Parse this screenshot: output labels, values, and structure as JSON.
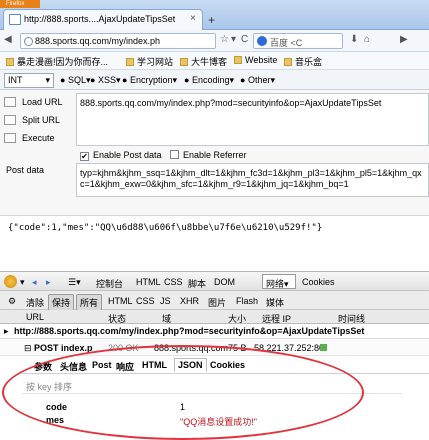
{
  "browser": {
    "brand_button": "Firefox",
    "tab_title": "http://888.sports....AjaxUpdateTipsSet",
    "tab_close": "×",
    "new_tab": "+",
    "url_bar": "888.sports.qq.com/my/index.ph",
    "search_placeholder": "百度 <C",
    "nav_back": "◀",
    "nav_forward": "▶",
    "dropdown_arrow": "▾",
    "reload": "C",
    "star": "☆",
    "home": "⌂",
    "download": "⬇"
  },
  "bookmarks": [
    {
      "label": "暴走漫画!因为你而存..."
    },
    {
      "label": "学习网站"
    },
    {
      "label": "大牛博客"
    },
    {
      "label": "Website"
    },
    {
      "label": "音乐盒"
    }
  ],
  "hackbar": {
    "select_value": "INT",
    "menus": [
      "SQL",
      "XSS",
      "Encryption",
      "Encoding",
      "Other"
    ],
    "actions": [
      "Load URL",
      "Split URL",
      "Execute"
    ],
    "url_value": "888.sports.qq.com/my/index.php?mod=securityinfo&op=AjaxUpdateTipsSet",
    "enable_post_label": "Enable Post data",
    "enable_post_checked": true,
    "enable_referrer_label": "Enable Referrer",
    "enable_referrer_checked": false,
    "post_label": "Post data",
    "post_value": "typ=kjhm&kjhm_ssq=1&kjhm_dlt=1&kjhm_fc3d=1&kjhm_pl3=1&kjhm_pl5=1&kjhm_qxc=1&kjhm_exw=0&kjhm_sfc=1&kjhm_r9=1&kjhm_jq=1&kjhm_bq=1"
  },
  "response_text": "{\"code\":1,\"mes\":\"QQ\\u6d88\\u606f\\u8bbe\\u7f6e\\u6210\\u529f!\"}",
  "firebug": {
    "toolbar": [
      "控制台",
      "HTML",
      "CSS",
      "脚本",
      "DOM",
      "网络",
      "Cookies"
    ],
    "network_arrow": "▾",
    "subbar": [
      "清除",
      "保持",
      "所有",
      "HTML",
      "CSS",
      "JS",
      "XHR",
      "图片",
      "Flash",
      "媒体"
    ],
    "columns": [
      "URL",
      "状态",
      "域",
      "大小",
      "远程 IP",
      "时间线"
    ],
    "request_url": "http://888.sports.qq.com/my/index.php?mod=securityinfo&op=AjaxUpdateTipsSet",
    "request_method_file": "POST index.p",
    "request_status": "200 OK",
    "request_domain": "888.sports.qq.com",
    "request_size": "75 B",
    "request_ip": "58.221.37.252:80",
    "detail_tabs": [
      "参数",
      "头信息",
      "Post",
      "响应",
      "HTML",
      "JSON",
      "Cookies"
    ],
    "json_sort_label": "按 key 排序",
    "json_rows": [
      {
        "key": "code",
        "value": "1"
      },
      {
        "key": "mes",
        "value": "\"QQ消息设置成功!\""
      }
    ]
  },
  "colors": {
    "highlight_ellipse": "#e0333d",
    "json_string": "#c0101a"
  }
}
